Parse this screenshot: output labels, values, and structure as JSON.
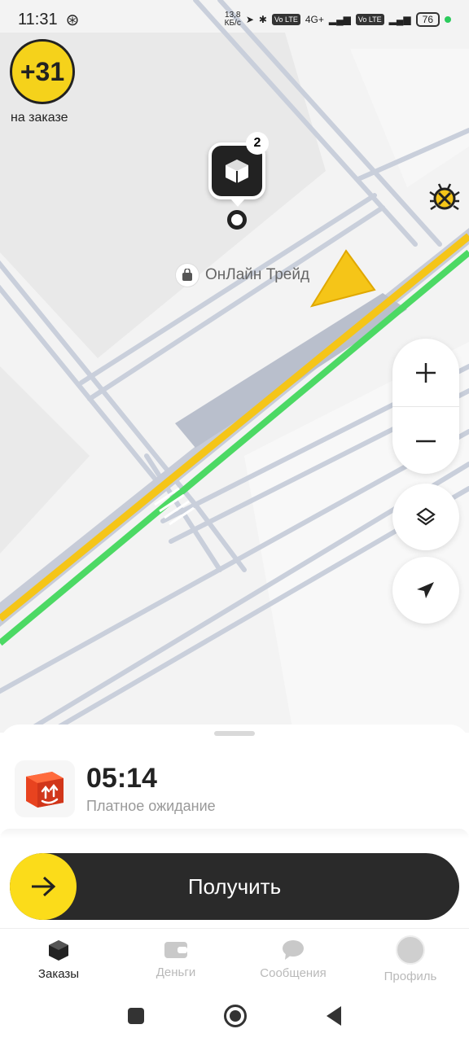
{
  "status_bar": {
    "time": "11:31",
    "speed_value": "13,8",
    "speed_unit": "КБ/с",
    "network": "4G+",
    "volte_1": "Vo LTE",
    "volte_2": "Vo LTE",
    "battery": "76"
  },
  "map": {
    "bonus_value": "+31",
    "bonus_label": "на заказе",
    "pin_count": "2",
    "poi_label": "ОнЛайн Трейд"
  },
  "order": {
    "timer": "05:14",
    "status": "Платное ожидание",
    "action_label": "Получить"
  },
  "tabs": [
    {
      "label": "Заказы",
      "icon": "box-icon",
      "active": true
    },
    {
      "label": "Деньги",
      "icon": "wallet-icon",
      "active": false
    },
    {
      "label": "Сообщения",
      "icon": "chat-icon",
      "active": false
    },
    {
      "label": "Профиль",
      "icon": "avatar",
      "active": false
    }
  ],
  "colors": {
    "accent_yellow": "#fbdc1a",
    "route_green": "#4cd964",
    "order_box_red": "#e8431f",
    "dark": "#2a2a2a"
  }
}
